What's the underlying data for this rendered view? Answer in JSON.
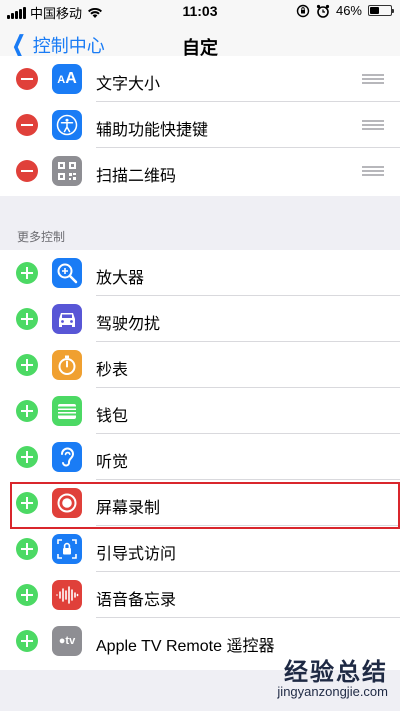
{
  "status_bar": {
    "carrier": "中国移动",
    "time": "11:03",
    "battery": "46%",
    "battery_level": 0.46
  },
  "nav": {
    "back_label": "控制中心",
    "title": "自定"
  },
  "included": [
    {
      "label": "文字大小",
      "icon": "text-size-icon",
      "color": "#1a7cf5"
    },
    {
      "label": "辅助功能快捷键",
      "icon": "accessibility-icon",
      "color": "#1a7cf5"
    },
    {
      "label": "扫描二维码",
      "icon": "qr-code-icon",
      "color": "#8e8e93"
    }
  ],
  "more_controls": {
    "header": "更多控制",
    "items": [
      {
        "label": "放大器",
        "icon": "magnifier-icon",
        "color": "#1a7cf5"
      },
      {
        "label": "驾驶勿扰",
        "icon": "car-icon",
        "color": "#5856d6"
      },
      {
        "label": "秒表",
        "icon": "stopwatch-icon",
        "color": "#f0a030"
      },
      {
        "label": "钱包",
        "icon": "wallet-icon",
        "color": "#4cd964"
      },
      {
        "label": "听觉",
        "icon": "ear-icon",
        "color": "#1a7cf5"
      },
      {
        "label": "屏幕录制",
        "icon": "screen-record-icon",
        "color": "#e0403a"
      },
      {
        "label": "引导式访问",
        "icon": "guided-access-icon",
        "color": "#1a7cf5"
      },
      {
        "label": "语音备忘录",
        "icon": "voice-memo-icon",
        "color": "#e0403a"
      },
      {
        "label": "Apple TV Remote 遥控器",
        "icon": "apple-tv-icon",
        "color": "#8e8e93"
      }
    ]
  },
  "watermark": {
    "line1": "经验总结",
    "line2": "jingyanzongjie.com"
  }
}
